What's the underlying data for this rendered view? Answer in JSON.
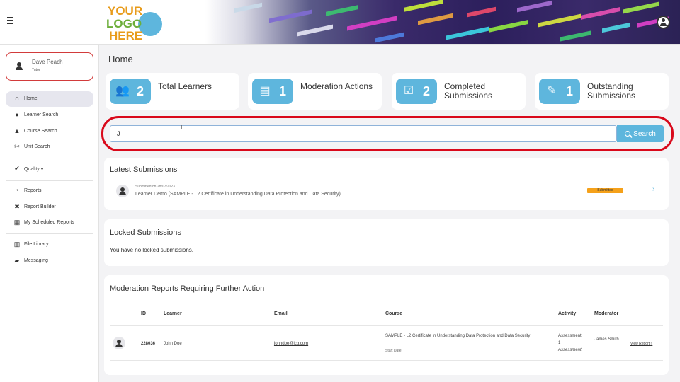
{
  "header": {
    "logo_text": "YOUR LOGO HERE"
  },
  "sidebar": {
    "profile": {
      "name": "Dave Peach",
      "role": "Tutor"
    },
    "items": [
      {
        "label": "Home",
        "icon": "home-icon"
      },
      {
        "label": "Learner Search",
        "icon": "user-search-icon"
      },
      {
        "label": "Course Search",
        "icon": "course-icon"
      },
      {
        "label": "Unit Search",
        "icon": "unit-icon"
      },
      {
        "label": "Quality",
        "icon": "check-circle-icon"
      },
      {
        "label": "Reports",
        "icon": "pie-chart-icon"
      },
      {
        "label": "Report Builder",
        "icon": "tools-icon"
      },
      {
        "label": "My Scheduled Reports",
        "icon": "calendar-icon"
      },
      {
        "label": "File Library",
        "icon": "library-icon"
      },
      {
        "label": "Messaging",
        "icon": "comment-icon"
      }
    ]
  },
  "main": {
    "title": "Home",
    "stats": [
      {
        "value": "2",
        "label": "Total Learners"
      },
      {
        "value": "1",
        "label": "Moderation Actions"
      },
      {
        "value": "2",
        "label": "Completed Submissions"
      },
      {
        "value": "1",
        "label": "Outstanding Submissions"
      }
    ],
    "search": {
      "value": "J",
      "button_label": "Search"
    },
    "latest": {
      "title": "Latest Submissions",
      "items": [
        {
          "date": "Submitted on 28/07/2023",
          "text": "Learner Demo (SAMPLE - L2 Certificate in Understanding Data Protection and Data Security)",
          "status": "Submitted"
        }
      ]
    },
    "locked": {
      "title": "Locked Submissions",
      "empty_text": "You have no locked submissions."
    },
    "moderation": {
      "title": "Moderation Reports Requiring Further Action",
      "columns": [
        "ID",
        "Learner",
        "Email",
        "Course",
        "Activity",
        "Moderator"
      ],
      "rows": [
        {
          "id": "228036",
          "learner": "John Doe",
          "email": "johndoe@lcg.com",
          "course": "SAMPLE - L2 Certificate in Understanding Data Protection and Data Security",
          "start_date": "Start Date:",
          "activity_line1": "Assessment",
          "activity_line2": "1",
          "activity_line3": "Assessment",
          "moderator": "James Smith",
          "action": "View Report"
        }
      ]
    }
  }
}
